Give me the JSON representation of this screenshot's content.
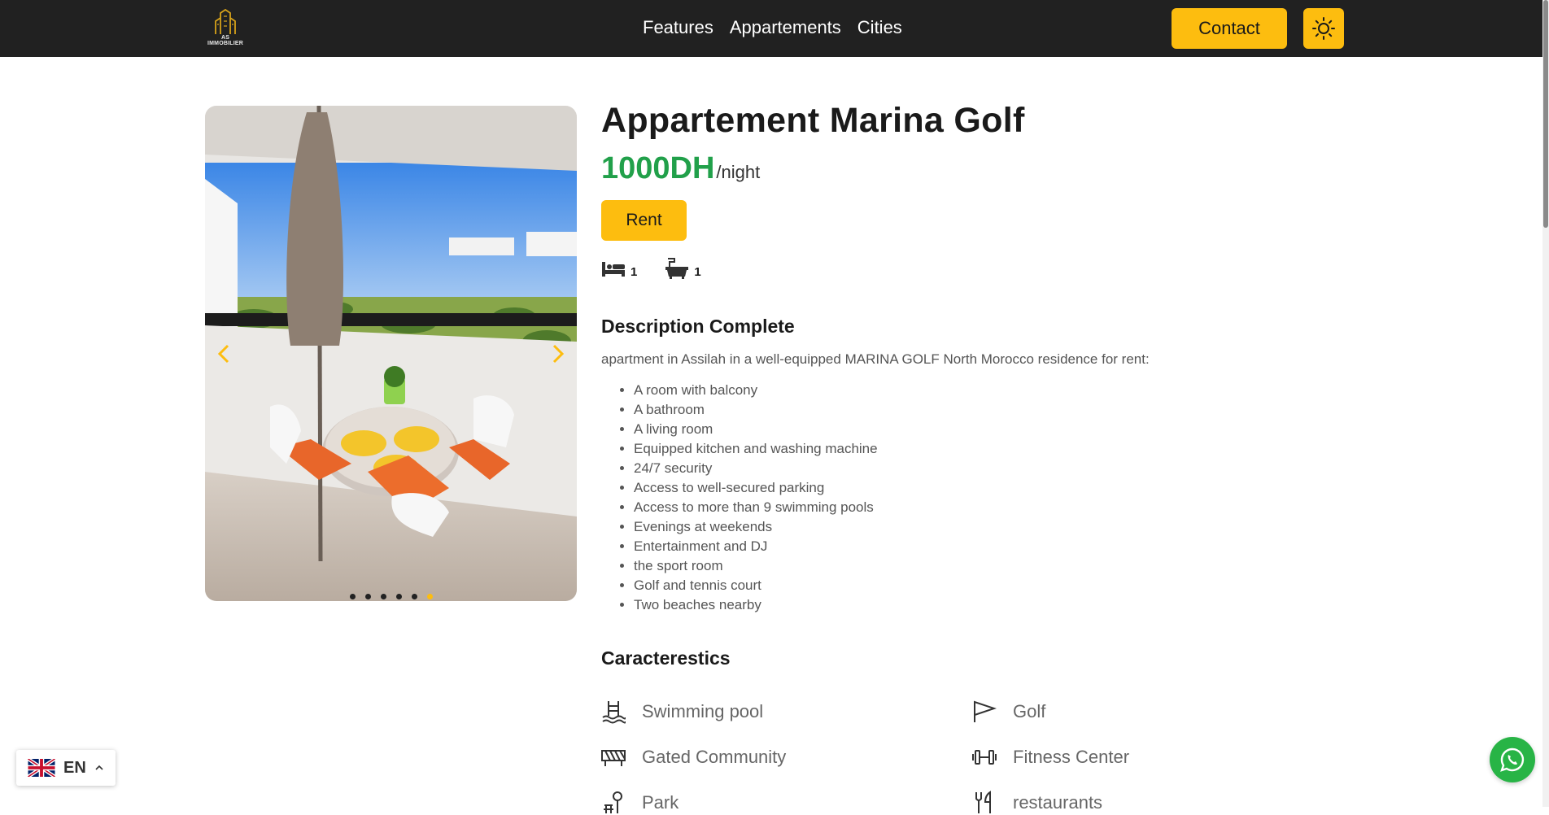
{
  "brand": {
    "logo_text": "AS IMMOBILIER"
  },
  "nav": {
    "links": [
      "Features",
      "Appartements",
      "Cities"
    ],
    "contact_label": "Contact",
    "theme_icon": "sun-icon"
  },
  "carousel": {
    "slide_count": 6,
    "active_index": 5
  },
  "listing": {
    "title": "Appartement Marina Golf",
    "price": "1000DH",
    "price_unit": "/night",
    "rent_label": "Rent",
    "bedrooms": "1",
    "bathrooms": "1"
  },
  "description": {
    "heading": "Description Complete",
    "intro": "apartment in Assilah in a well-equipped MARINA GOLF North Morocco residence for rent:",
    "items": [
      "A room with balcony",
      "A bathroom",
      "A living room",
      "Equipped kitchen and washing machine",
      "24/7 security",
      "Access to well-secured parking",
      "Access to more than 9 swimming pools",
      "Evenings at weekends",
      "Entertainment and DJ",
      "the sport room",
      "Golf and tennis court",
      "Two beaches nearby"
    ]
  },
  "characteristics": {
    "heading": "Caracterestics",
    "items": [
      {
        "label": "Swimming pool",
        "icon": "pool-icon"
      },
      {
        "label": "Golf",
        "icon": "flag-icon"
      },
      {
        "label": "Gated Community",
        "icon": "gate-icon"
      },
      {
        "label": "Fitness Center",
        "icon": "dumbbell-icon"
      },
      {
        "label": "Park",
        "icon": "park-icon"
      },
      {
        "label": "restaurants",
        "icon": "utensils-icon"
      }
    ]
  },
  "language": {
    "code": "EN",
    "flag": "uk-flag-icon"
  },
  "colors": {
    "accent": "#fdbd0f",
    "price": "#21a04a",
    "navbar": "#212121",
    "whatsapp": "#28b446"
  }
}
